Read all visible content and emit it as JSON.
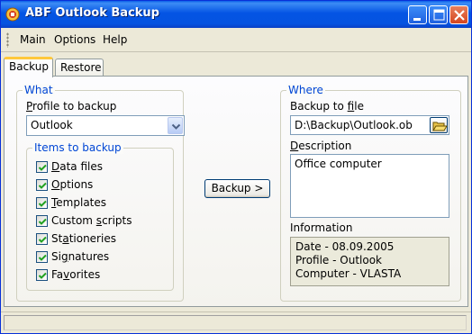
{
  "window": {
    "title": "ABF Outlook Backup"
  },
  "menu": {
    "items": [
      "Main",
      "Options",
      "Help"
    ]
  },
  "tabs": [
    {
      "label": "Backup",
      "active": true
    },
    {
      "label": "Restore",
      "active": false
    }
  ],
  "what": {
    "legend": "What",
    "profile_label_hotkey": "P",
    "profile_label_rest": "rofile to backup",
    "profile_value": "Outlook",
    "items_legend": "Items to backup",
    "items": [
      {
        "pre": "",
        "hot": "D",
        "post": "ata files",
        "checked": true
      },
      {
        "pre": "",
        "hot": "O",
        "post": "ptions",
        "checked": true
      },
      {
        "pre": "",
        "hot": "T",
        "post": "emplates",
        "checked": true
      },
      {
        "pre": "Custom ",
        "hot": "s",
        "post": "cripts",
        "checked": true
      },
      {
        "pre": "St",
        "hot": "a",
        "post": "tioneries",
        "checked": true
      },
      {
        "pre": "Si",
        "hot": "g",
        "post": "natures",
        "checked": true
      },
      {
        "pre": "Fa",
        "hot": "v",
        "post": "orites",
        "checked": true
      }
    ]
  },
  "backup_button": "Backup >",
  "where": {
    "legend": "Where",
    "file_label_pre": "Backup to ",
    "file_label_hot": "f",
    "file_label_post": "ile",
    "file_value": "D:\\Backup\\Outlook.ob",
    "description_label_hot": "D",
    "description_label_rest": "escription",
    "description_value": "Office computer",
    "information_label": "Information",
    "information_lines": [
      "Date - 08.09.2005",
      "Profile - Outlook",
      "Computer - VLASTA"
    ]
  },
  "colors": {
    "titlebar": "#0454e4",
    "legend_text": "#0046d5",
    "check_mark": "#21a121",
    "active_tab_accent": "#ffc83c"
  },
  "icons": {
    "app": "outlook-backup-app-icon",
    "minimize": "minimize-icon",
    "maximize": "maximize-icon",
    "close": "close-icon",
    "dropdown": "chevron-down-icon",
    "browse": "open-folder-icon",
    "check": "checkmark-icon"
  }
}
